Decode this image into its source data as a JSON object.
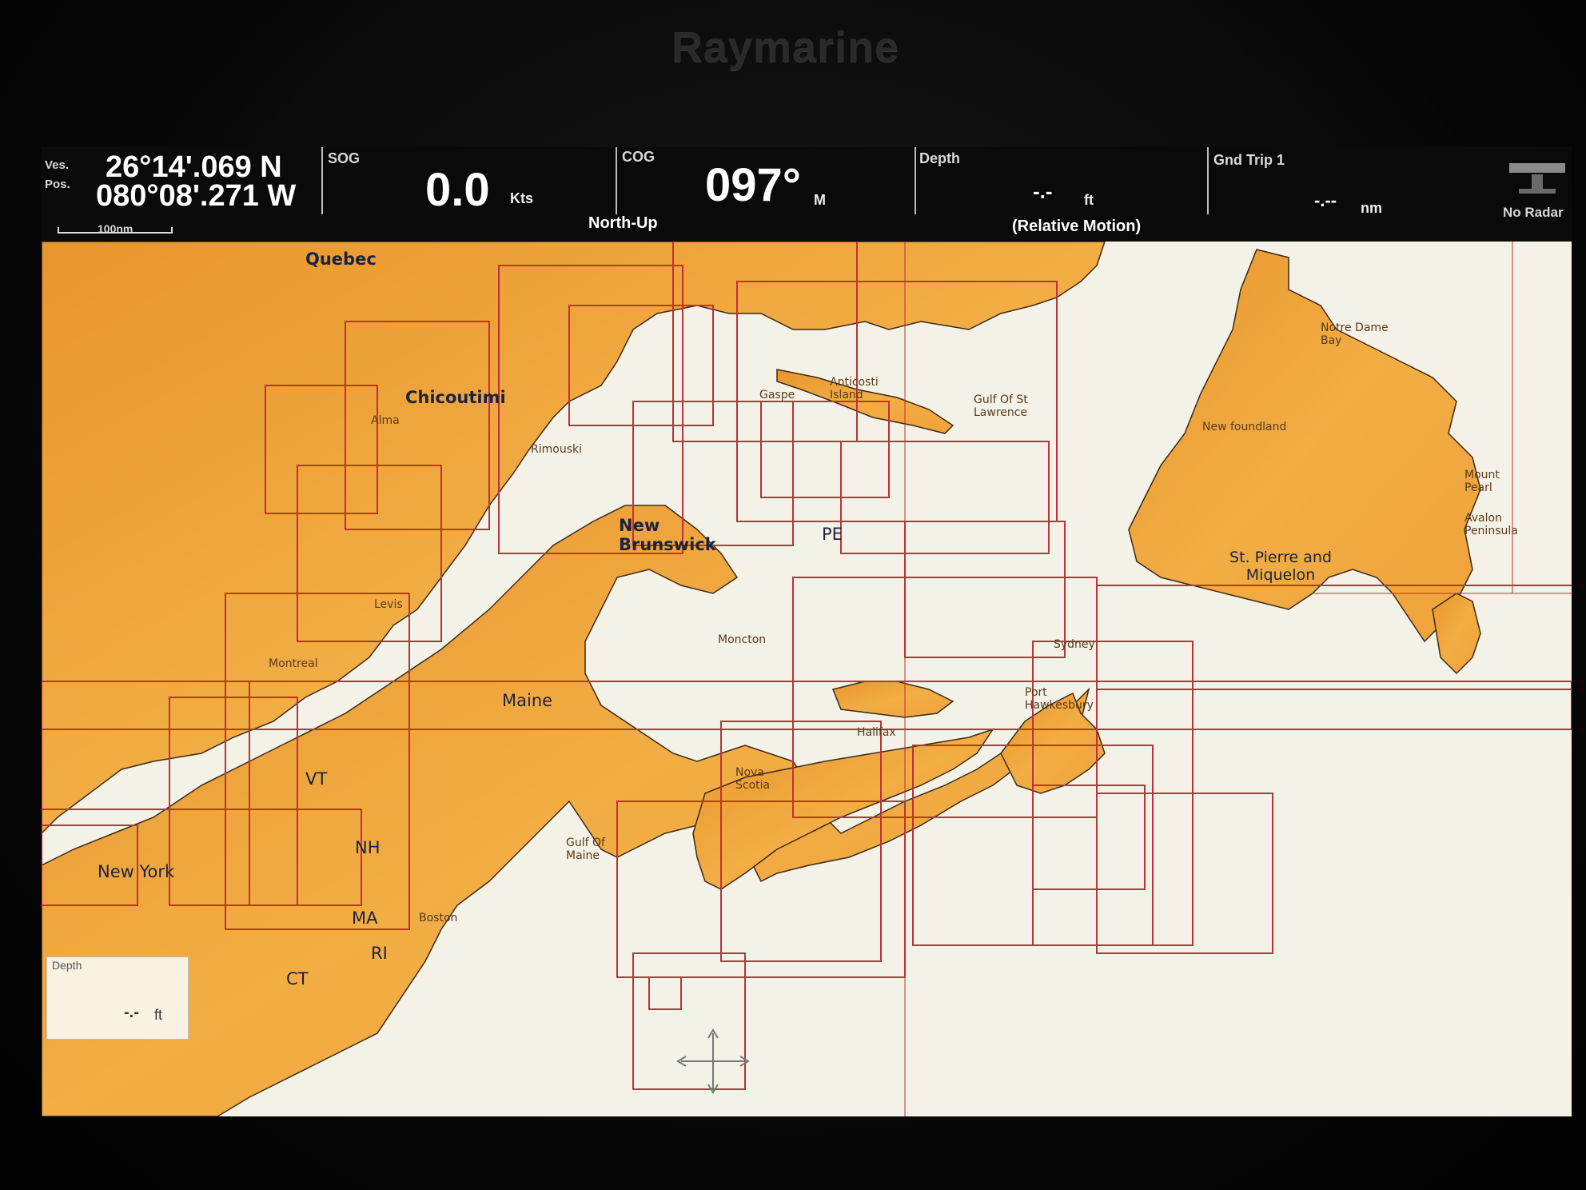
{
  "brand": "Raymarine",
  "position": {
    "label_top": "Ves.",
    "label_bottom": "Pos.",
    "lat": "26°14'.069 N",
    "lon": "080°08'.271 W"
  },
  "scale_label": "100nm",
  "sog": {
    "label": "SOG",
    "value": "0.0",
    "unit": "Kts"
  },
  "cog": {
    "label": "COG",
    "value": "097°",
    "unit": "M"
  },
  "orientation": "North-Up",
  "depth": {
    "label": "Depth",
    "value": "-.-",
    "unit": "ft"
  },
  "motion_mode": "(Relative Motion)",
  "trip": {
    "label": "Gnd Trip 1",
    "value": "-.--",
    "unit": "nm"
  },
  "radar_status": "No Radar",
  "depth_box": {
    "label": "Depth",
    "value": "-.-",
    "unit": "ft"
  },
  "colors": {
    "land": "#f0a93a",
    "water": "#f4f1e6",
    "chart_outline": "#c0303a",
    "databar": "#0a0a0a"
  },
  "icons": [
    "radar-icon",
    "crosshair-cursor-icon"
  ],
  "place_labels": {
    "quebec": "Quebec",
    "chicoutimi": "Chicoutimi",
    "alma": "Alma",
    "rimouski": "Rimouski",
    "anticosti": "Anticosti Island",
    "gaspe": "Gaspe",
    "gulf_st_lawrence": "Gulf Of St Lawrence",
    "new_brunswick": "New Brunswick",
    "pe": "PE",
    "notre_dame": "Notre Dame Bay",
    "newfoundland": "New foundland",
    "mount_pearl": "Mount Pearl",
    "avalon": "Avalon Peninsula",
    "st_pierre": "St. Pierre and Miquelon",
    "levis": "Levis",
    "montreal": "Montreal",
    "moncton": "Moncton",
    "sydney": "Sydney",
    "port_hawkesbury": "Port Hawkesbury",
    "halifax": "Halifax",
    "nova_scotia": "Nova Scotia",
    "maine": "Maine",
    "vt": "VT",
    "nh": "NH",
    "ma": "MA",
    "ri": "RI",
    "ct": "CT",
    "new_york": "New York",
    "boston": "Boston",
    "gulf_of_maine": "Gulf Of Maine"
  }
}
